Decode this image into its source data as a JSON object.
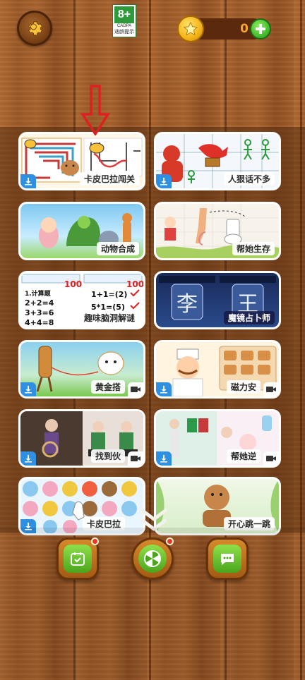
{
  "header": {
    "settings_icon": "gear-icon",
    "age_rating": {
      "number": "8+",
      "org": "CADPA",
      "caption": "适龄提示"
    },
    "coins": {
      "count": "0",
      "icon": "star-coin-icon",
      "add_icon": "plus-icon"
    }
  },
  "games": [
    {
      "label": "卡皮巴拉闯关",
      "badge": "download",
      "art": "maze"
    },
    {
      "label": "人狠话不多",
      "badge": "download",
      "art": "dragon"
    },
    {
      "label": "动物合成",
      "badge": "none",
      "art": "animals"
    },
    {
      "label": "帮她生存",
      "badge": "none",
      "art": "toilet"
    },
    {
      "label": "趣味脑洞解谜",
      "badge": "none",
      "art": "math"
    },
    {
      "label": "魔镜占卜师",
      "badge": "none",
      "art": "mirror"
    },
    {
      "label": "黄金搭",
      "badge": "download-video",
      "art": "golden"
    },
    {
      "label": "磁力安",
      "badge": "download-video",
      "art": "chef"
    },
    {
      "label": "找到伙",
      "badge": "download-video",
      "art": "room"
    },
    {
      "label": "帮她逆",
      "badge": "download-video",
      "art": "fashion"
    },
    {
      "label": "卡皮巴拉",
      "badge": "download",
      "art": "bears"
    },
    {
      "label": "开心跳一跳",
      "badge": "none",
      "art": "jump"
    }
  ],
  "bottom_nav": [
    {
      "icon": "calendar-check-icon",
      "has_dot": true
    },
    {
      "icon": "wheel-icon",
      "has_dot": true
    },
    {
      "icon": "chat-icon",
      "has_dot": false
    }
  ],
  "colors": {
    "wood": "#a3602c",
    "accent_green": "#4aa51c",
    "coin": "#f5b41a",
    "arrow": "#e02020"
  }
}
